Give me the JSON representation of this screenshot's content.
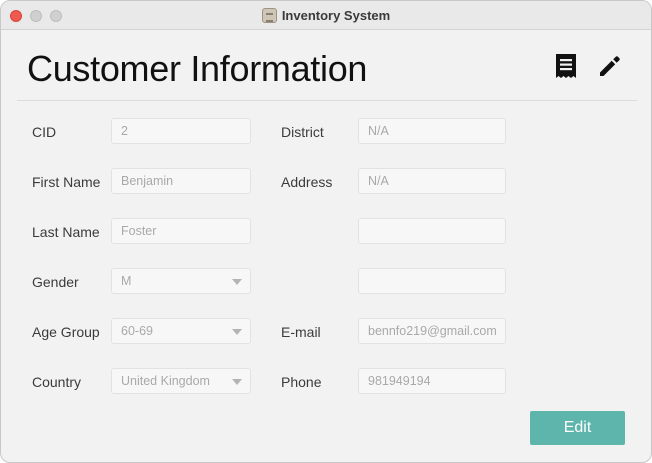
{
  "window": {
    "title": "Inventory System"
  },
  "header": {
    "title": "Customer Information"
  },
  "icons": {
    "receipt": "receipt-icon",
    "edit": "pencil-icon",
    "app": "inventory-app-icon"
  },
  "form": {
    "cid": {
      "label": "CID",
      "value": "2"
    },
    "first_name": {
      "label": "First Name",
      "value": "Benjamin"
    },
    "last_name": {
      "label": "Last Name",
      "value": "Foster"
    },
    "gender": {
      "label": "Gender",
      "value": "M"
    },
    "age_group": {
      "label": "Age Group",
      "value": "60-69"
    },
    "country": {
      "label": "Country",
      "value": "United Kingdom"
    },
    "district": {
      "label": "District",
      "value": "N/A"
    },
    "address": {
      "label": "Address",
      "value": "N/A"
    },
    "address_line2": {
      "value": ""
    },
    "address_line3": {
      "value": ""
    },
    "email": {
      "label": "E-mail",
      "value": "bennfo219@gmail.com"
    },
    "phone": {
      "label": "Phone",
      "value": "981949194"
    }
  },
  "actions": {
    "edit_label": "Edit"
  },
  "colors": {
    "accent": "#5db5ac",
    "close": "#ee5a52"
  }
}
